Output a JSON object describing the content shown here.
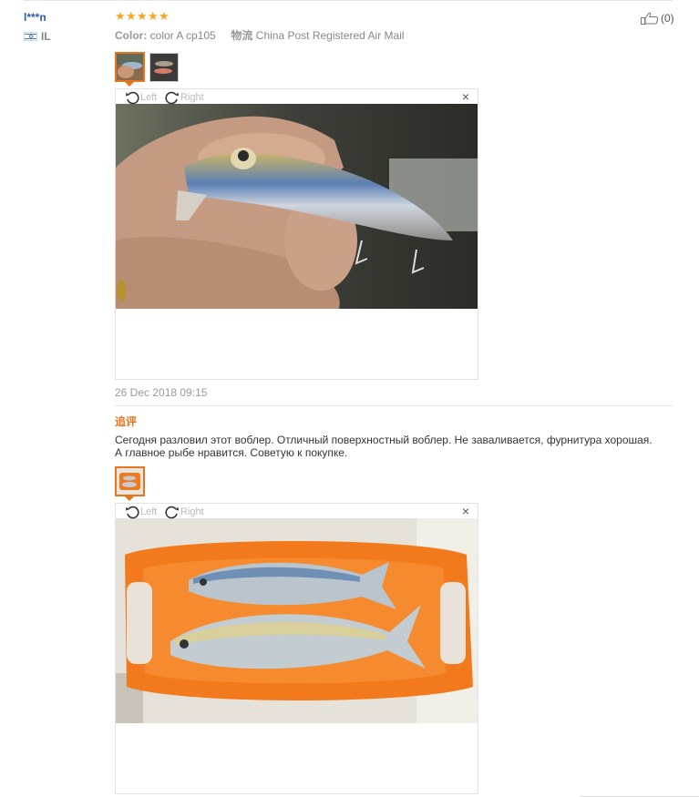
{
  "review": {
    "buyer_name": "l***n",
    "country_code": "IL",
    "rating": 5,
    "helpful_count": "(0)",
    "color_label": "Color:",
    "color_value": "color A cp105",
    "logistics_label": "物流",
    "logistics_value": "China Post Registered Air Mail",
    "date": "26 Dec 2018 09:15",
    "viewer": {
      "rotate_left": "Left",
      "rotate_right": "Right",
      "close": "×"
    },
    "followup_label": "追评",
    "followup_text": "Сегодня разловил этот воблер. Отличный поверхностный воблер. Не заваливается, фурнитура хорошая. А главное рыбе нравится. Советую к покупке."
  },
  "icons": {
    "star": "star-icon",
    "thumbs_up": "thumbs-up-icon",
    "rotate_left": "rotate-left-icon",
    "rotate_right": "rotate-right-icon",
    "close": "close-icon",
    "flag": "israel-flag-icon"
  },
  "colors": {
    "accent": "#e8741c",
    "star": "#f5a623",
    "name_link": "#2a5ca8"
  }
}
